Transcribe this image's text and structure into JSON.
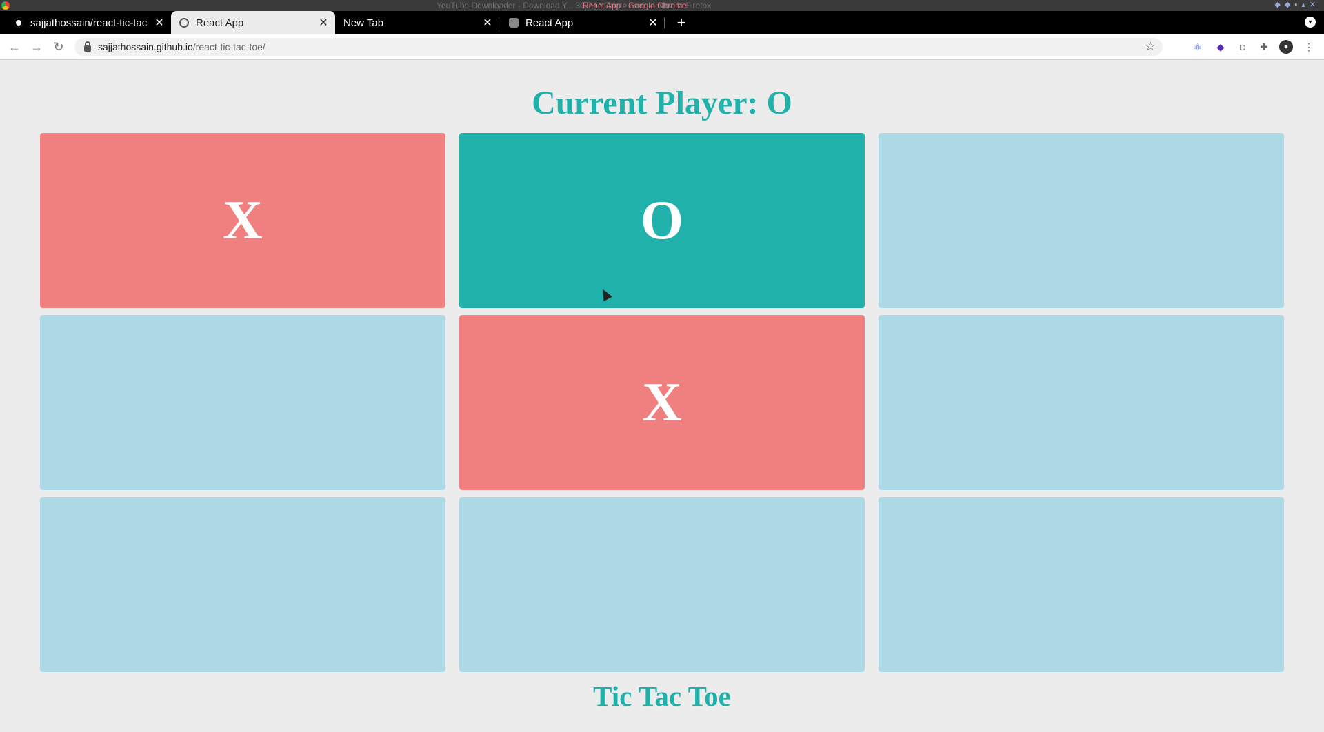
{
  "window": {
    "title_behind": "YouTube Downloader - Download Y... 3GP | Y2mate.com — Mozilla Firefox",
    "title": "React App - Google Chrome"
  },
  "tabs": [
    {
      "label": "sajjathossain/react-tic-tac",
      "icon": "github-icon"
    },
    {
      "label": "React App",
      "icon": "globe-icon",
      "active": true
    },
    {
      "label": "New Tab",
      "icon": ""
    },
    {
      "label": "React App",
      "icon": "database-icon"
    }
  ],
  "toolbar": {
    "url_host": "sajjathossain.github.io",
    "url_path": "/react-tic-tac-toe/"
  },
  "game": {
    "current_player_text": "Current Player: O",
    "title": "Tic Tac Toe",
    "board": [
      "X",
      "O",
      "",
      "",
      "X",
      "",
      "",
      "",
      ""
    ]
  },
  "colors": {
    "x_cell": "#f08080",
    "o_cell": "#20b2aa",
    "empty_cell": "#add8e6",
    "heading": "#20b2aa"
  }
}
